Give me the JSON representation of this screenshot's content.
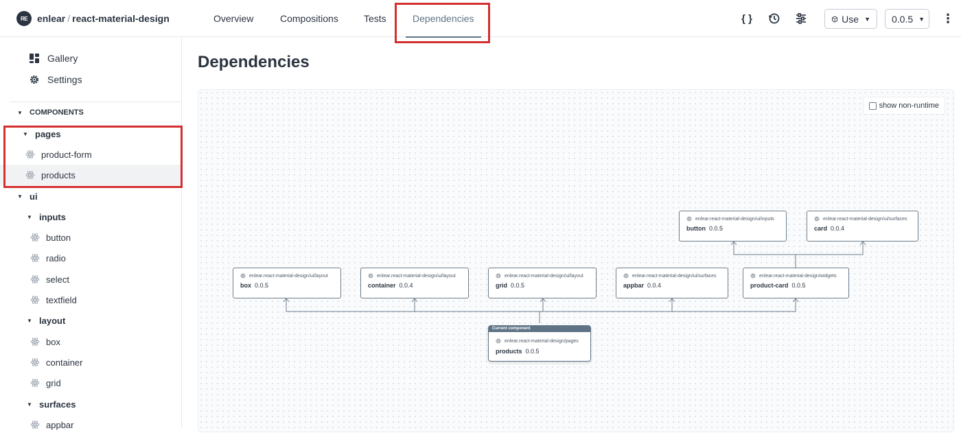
{
  "header": {
    "logo_text": "RE",
    "owner": "enlear",
    "separator": "/",
    "project": "react-material-design",
    "tabs": [
      {
        "label": "Overview"
      },
      {
        "label": "Compositions"
      },
      {
        "label": "Tests"
      },
      {
        "label": "Dependencies",
        "active": true
      }
    ],
    "icons": [
      "code-braces-icon",
      "history-icon",
      "settings-sliders-icon"
    ],
    "use_label": "Use",
    "version_label": "0.0.5",
    "more_icon": "more-vertical-icon",
    "highlight_color": "#d32f2f"
  },
  "sidebar": {
    "links": [
      {
        "label": "Gallery",
        "icon": "gallery-grid-icon"
      },
      {
        "label": "Settings",
        "icon": "gear-icon"
      }
    ],
    "components_header": "COMPONENTS",
    "tree": [
      {
        "label": "pages",
        "type": "folder"
      },
      {
        "label": "product-form",
        "type": "component"
      },
      {
        "label": "products",
        "type": "component",
        "selected": true
      },
      {
        "label": "ui",
        "type": "folder"
      },
      {
        "label": "inputs",
        "type": "folder"
      },
      {
        "label": "button",
        "type": "component"
      },
      {
        "label": "radio",
        "type": "component"
      },
      {
        "label": "select",
        "type": "component"
      },
      {
        "label": "textfield",
        "type": "component"
      },
      {
        "label": "layout",
        "type": "folder"
      },
      {
        "label": "box",
        "type": "component"
      },
      {
        "label": "container",
        "type": "component"
      },
      {
        "label": "grid",
        "type": "component"
      },
      {
        "label": "surfaces",
        "type": "folder"
      },
      {
        "label": "appbar",
        "type": "component"
      }
    ]
  },
  "main": {
    "title": "Dependencies",
    "show_non_runtime_label": "show non-runtime",
    "show_non_runtime_checked": false,
    "graph": {
      "current": {
        "badge": "Current component",
        "scope": "enlear.react-material-design/pages",
        "name": "products",
        "version": "0.0.5"
      },
      "dependencies": [
        {
          "scope": "enlear.react-material-design/ui/layout",
          "name": "box",
          "version": "0.0.5"
        },
        {
          "scope": "enlear.react-material-design/ui/layout",
          "name": "container",
          "version": "0.0.4"
        },
        {
          "scope": "enlear.react-material-design/ui/layout",
          "name": "grid",
          "version": "0.0.5"
        },
        {
          "scope": "enlear.react-material-design/ui/surfaces",
          "name": "appbar",
          "version": "0.0.4"
        },
        {
          "scope": "enlear.react-material-design/widgets",
          "name": "product-card",
          "version": "0.0.5"
        }
      ],
      "transitive": [
        {
          "scope": "enlear.react-material-design/ui/inputs",
          "name": "button",
          "version": "0.0.5"
        },
        {
          "scope": "enlear.react-material-design/ui/surfaces",
          "name": "card",
          "version": "0.0.4"
        }
      ]
    }
  }
}
